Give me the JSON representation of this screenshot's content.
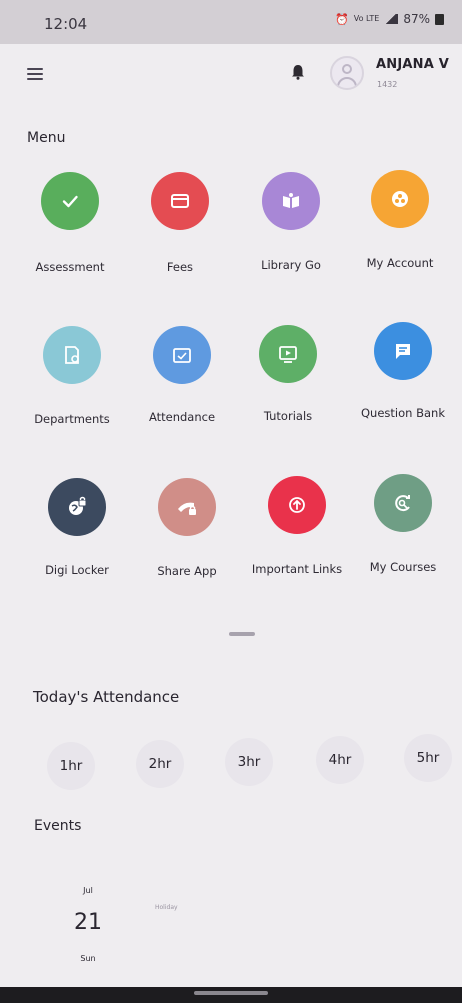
{
  "status_bar": {
    "time": "12:04",
    "network_label": "Vo LTE",
    "battery": "87%"
  },
  "header": {
    "user_name": "ANJANA V",
    "user_id": "1432"
  },
  "menu": {
    "title": "Menu",
    "items": [
      {
        "label": "Assessment",
        "icon": "checkmark-icon",
        "color": "#59ae5c"
      },
      {
        "label": "Fees",
        "icon": "card-icon",
        "color": "#e44c52"
      },
      {
        "label": "Library Go",
        "icon": "book-icon",
        "color": "#a887d6"
      },
      {
        "label": "My Account",
        "icon": "account-icon",
        "color": "#f6a534"
      },
      {
        "label": "Departments",
        "icon": "department-icon",
        "color": "#8ac8d6"
      },
      {
        "label": "Attendance",
        "icon": "attendance-icon",
        "color": "#5f9ae0"
      },
      {
        "label": "Tutorials",
        "icon": "video-icon",
        "color": "#5eaf67"
      },
      {
        "label": "Question Bank",
        "icon": "chat-icon",
        "color": "#3c8fe0"
      },
      {
        "label": "Digi Locker",
        "icon": "globe-lock-icon",
        "color": "#3c4a5f"
      },
      {
        "label": "Share App",
        "icon": "share-icon",
        "color": "#d08e88"
      },
      {
        "label": "Important Links",
        "icon": "link-icon",
        "color": "#e9324b"
      },
      {
        "label": "My Courses",
        "icon": "courses-icon",
        "color": "#6f9e85"
      }
    ]
  },
  "attendance": {
    "title": "Today's Attendance",
    "hours": [
      "1hr",
      "2hr",
      "3hr",
      "4hr",
      "5hr"
    ]
  },
  "events": {
    "title": "Events",
    "month": "Jul",
    "day": "21",
    "weekday": "Sun",
    "event_text": "Holiday"
  }
}
